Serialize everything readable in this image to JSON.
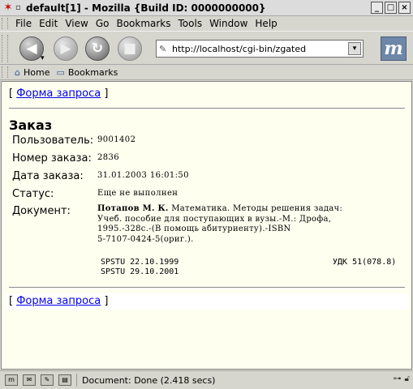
{
  "window": {
    "title": "default[1] - Mozilla {Build ID: 0000000000}",
    "buttons": [
      "_",
      "□",
      "×"
    ]
  },
  "menu": [
    "File",
    "Edit",
    "View",
    "Go",
    "Bookmarks",
    "Tools",
    "Window",
    "Help"
  ],
  "nav": {
    "url": "http://localhost/cgi-bin/zgated"
  },
  "personal_toolbar": {
    "home": "Home",
    "bookmarks": "Bookmarks"
  },
  "page": {
    "top_link": "Форма запроса",
    "heading": "Заказ",
    "fields": {
      "user_label": "Пользователь:",
      "user_value": "9001402",
      "order_no_label": "Номер заказа:",
      "order_no_value": "2836",
      "order_date_label": "Дата заказа:",
      "order_date_value": "31.01.2003 16:01:50",
      "status_label": "Статус:",
      "status_value": "Еще не выполнен",
      "document_label": "Документ:"
    },
    "document": {
      "author": "Потапов М. К.",
      "line1_rest": "Математика. Методы решения задач:",
      "line2": "Учеб. пособие для поступающих в вузы.-М.: Дрофа,",
      "line3": "1995.-328с.-(В помощь абитуриенту).-ISBN",
      "line4": "5-7107-0424-5(ориг.).",
      "holding1": "SPSTU 22.10.1999",
      "udk": "УДК 51(078.8)",
      "holding2": "SPSTU 29.10.2001"
    },
    "bottom_link": "Форма запроса"
  },
  "status": {
    "text": "Document: Done (2.418 secs)"
  },
  "colors": {
    "page_bg": "#fffff0",
    "link": "#0000ee",
    "chrome": "#d6d6ce"
  }
}
